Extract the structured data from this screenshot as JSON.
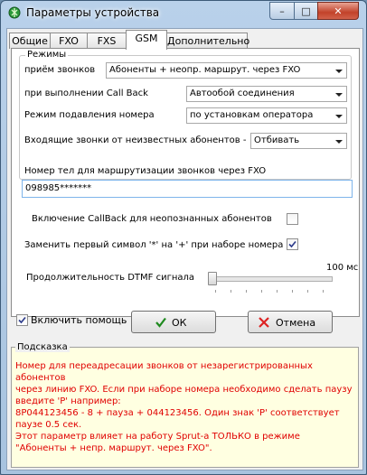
{
  "window": {
    "title": "Параметры устройства",
    "buttons": {
      "minimize": "–",
      "maximize": "□",
      "close": "✕"
    }
  },
  "tabs": [
    {
      "label": "Общие",
      "active": false
    },
    {
      "label": "FXO",
      "active": false
    },
    {
      "label": "FXS",
      "active": false
    },
    {
      "label": "GSM",
      "active": true
    },
    {
      "label": "Дополнительно",
      "active": false
    }
  ],
  "modes": {
    "legend": "Режимы",
    "incoming_label": "приём звонков",
    "incoming_value": "Абоненты + неопр. маршрут. через FXO",
    "callback_label": "при выполнении Call Back",
    "callback_value": "Автообой соединения",
    "suppress_label": "Режим подавления номера",
    "suppress_value": "по установкам оператора",
    "unknown_label": "Входящие звонки от неизвестных абонентов -",
    "unknown_value": "Отбивать"
  },
  "route": {
    "label": "Номер тел для маршрутизации звонков через FXO",
    "value": "098985*******"
  },
  "callback_unknown": {
    "label": "Включение CallBack для неопознанных абонентов",
    "checked": false
  },
  "replace_symbol": {
    "label": "Заменить первый символ '*' на '+' при наборе номера",
    "checked": true
  },
  "dtmf": {
    "label": "Продолжительность DTMF сигнала",
    "value_text": "100 мс"
  },
  "help_checkbox": {
    "label": "Включить помощь",
    "checked": true
  },
  "ok_button": "ОК",
  "cancel_button": "Отмена",
  "hint": {
    "legend": "Подсказка",
    "text": " Номер для переадресации звонков от незарегистрированных абонентов\nчерез линию FXO. Если при наборе номера необходимо сделать паузу\nвведите 'P' например:\n8P044123456  - 8 + пауза + 044123456. Один знак 'P' соответствует\nпаузе 0.5 сек.\n Этот параметр влияет на работу Sprut-a ТОЛЬКО в режиме\n\"Абоненты + непр. маршрут. через FXO\"."
  },
  "colors": {
    "hint_text": "#e00000",
    "hint_bg": "#ffffe1",
    "titlebar": "#b9d1ea"
  },
  "icons": [
    "app-icon",
    "dropdown-arrow-icon",
    "check-icon",
    "cross-icon"
  ]
}
